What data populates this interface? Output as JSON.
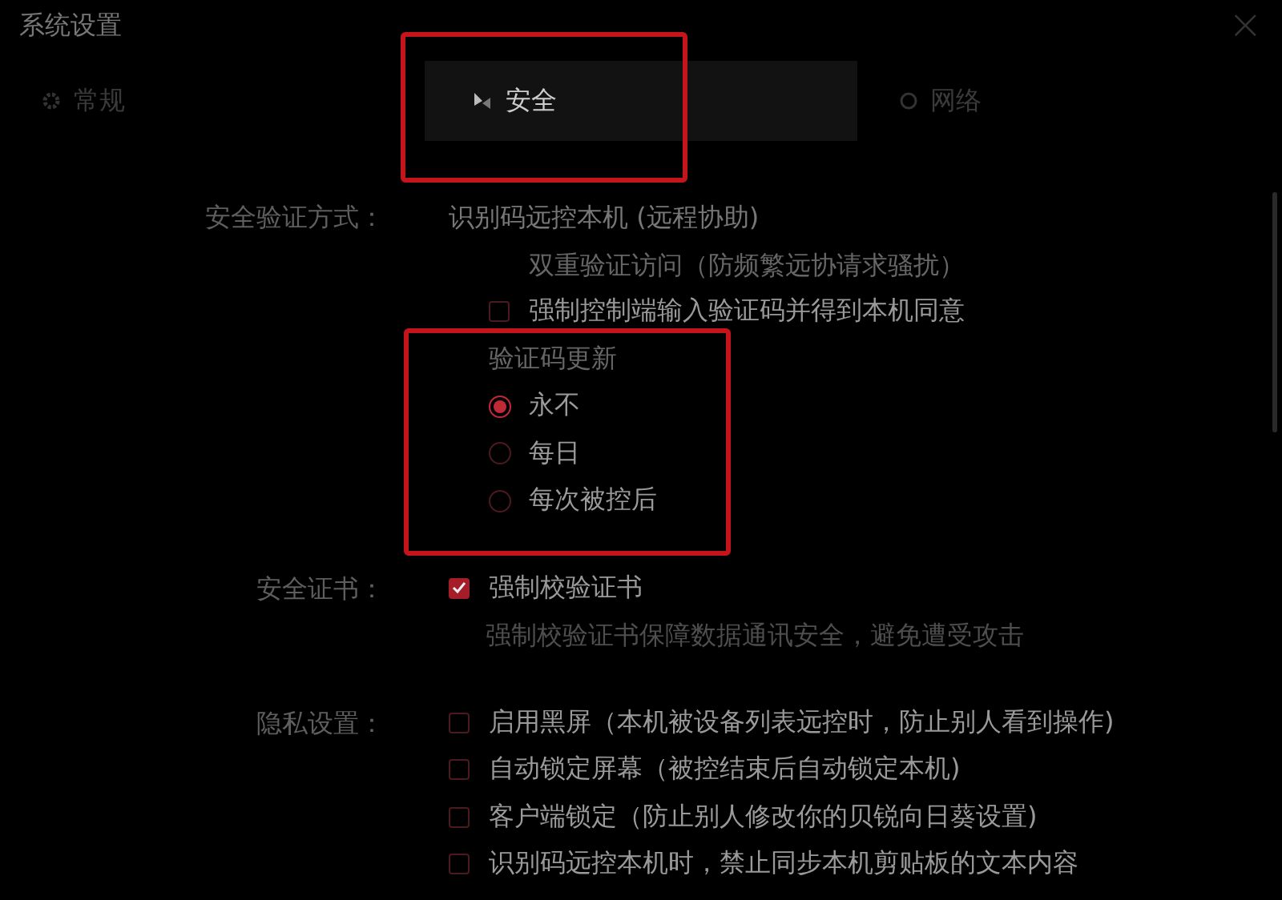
{
  "window": {
    "title": "系统设置",
    "close": "×"
  },
  "tabs": [
    {
      "label": "常规",
      "selected": false,
      "highlighted": false
    },
    {
      "label": "安全",
      "selected": true,
      "highlighted": true
    },
    {
      "label": "网络",
      "selected": false,
      "highlighted": false
    }
  ],
  "sections": [
    {
      "label": "安全验证方式：",
      "items": [
        {
          "kind": "title",
          "text": "识别码远控本机 (远程协助)",
          "children": [
            {
              "kind": "subtitle",
              "text": "双重验证访问（防频繁远协请求骚扰）"
            },
            {
              "kind": "checkbox",
              "label": "强制控制端输入验证码并得到本机同意",
              "checked": false
            },
            {
              "kind": "radio_group",
              "title": "验证码更新",
              "highlighted": true,
              "options": [
                {
                  "label": "永不",
                  "selected": true
                },
                {
                  "label": "每日",
                  "selected": false
                },
                {
                  "label": "每次被控后",
                  "selected": false
                }
              ]
            }
          ]
        }
      ]
    },
    {
      "label": "安全证书：",
      "items": [
        {
          "kind": "checkbox",
          "label": "强制校验证书",
          "checked": true
        },
        {
          "kind": "note",
          "text": "强制校验证书保障数据通讯安全，避免遭受攻击"
        }
      ]
    },
    {
      "label": "隐私设置：",
      "items": [
        {
          "kind": "checkbox",
          "label": "启用黑屏（本机被设备列表远控时，防止别人看到操作)",
          "checked": false
        },
        {
          "kind": "checkbox",
          "label": "自动锁定屏幕（被控结束后自动锁定本机)",
          "checked": false
        },
        {
          "kind": "checkbox",
          "label": "客户端锁定（防止别人修改你的贝锐向日葵设置)",
          "checked": false
        },
        {
          "kind": "checkbox",
          "label": "识别码远控本机时，禁止同步本机剪贴板的文本内容",
          "checked": false
        }
      ]
    }
  ]
}
